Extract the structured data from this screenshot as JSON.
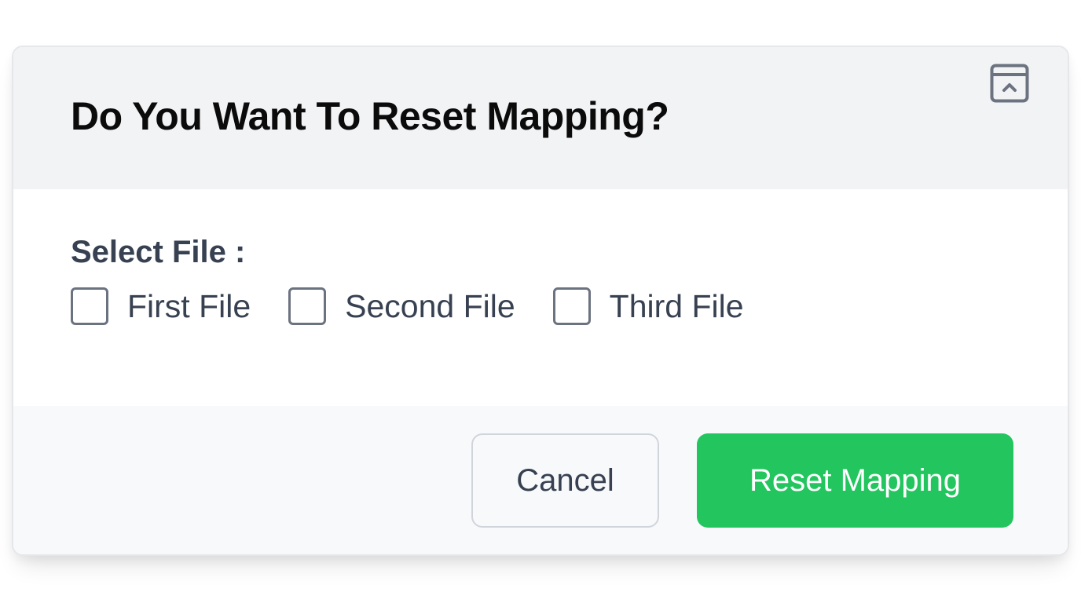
{
  "dialog": {
    "title": "Do You Want To Reset Mapping?",
    "collapse_icon": "panel-collapse-up-icon",
    "select_label": "Select File :",
    "options": [
      {
        "label": "First File",
        "checked": false
      },
      {
        "label": "Second File",
        "checked": false
      },
      {
        "label": "Third File",
        "checked": false
      }
    ],
    "cancel_label": "Cancel",
    "confirm_label": "Reset Mapping"
  },
  "colors": {
    "header_bg": "#f2f3f5",
    "footer_bg": "#f8f9fb",
    "confirm_bg": "#22c55e",
    "title_text": "#0b0b0c",
    "body_text": "#374151",
    "icon_stroke": "#6b7280"
  }
}
